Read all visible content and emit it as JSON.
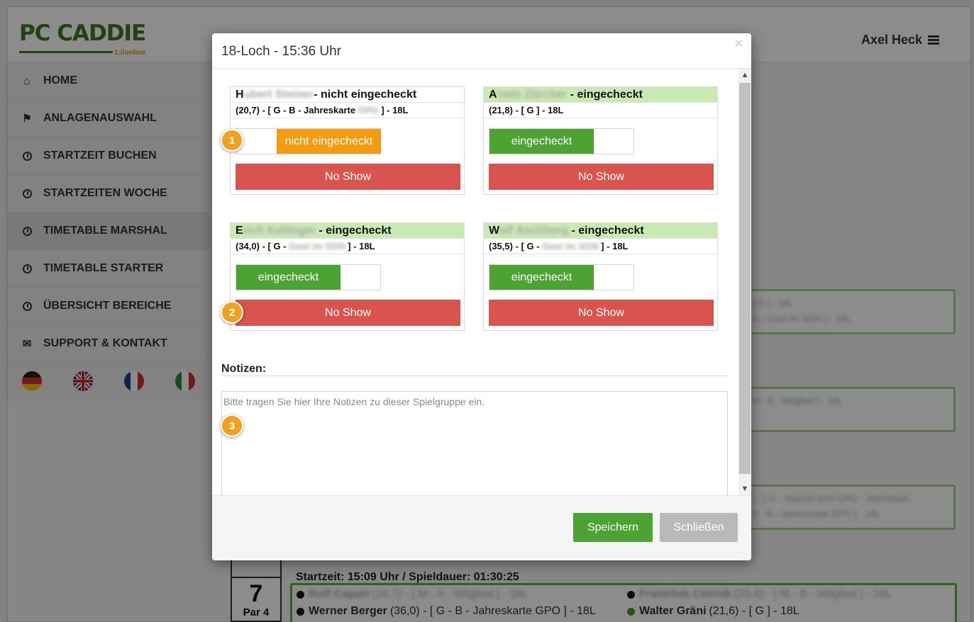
{
  "app": {
    "logo": "PC CADDIE",
    "logo_sub": "1://online",
    "user": "Axel Heck"
  },
  "sidebar": {
    "items": [
      {
        "label": "HOME",
        "icon": "home-icon"
      },
      {
        "label": "ANLAGENAUSWAHL",
        "icon": "flag-icon"
      },
      {
        "label": "STARTZEIT BUCHEN",
        "icon": "clock-icon"
      },
      {
        "label": "STARTZEITEN WOCHE",
        "icon": "clock-icon"
      },
      {
        "label": "TIMETABLE MARSHAL",
        "icon": "clock-icon",
        "active": true
      },
      {
        "label": "TIMETABLE STARTER",
        "icon": "clock-icon"
      },
      {
        "label": "ÜBERSICHT BEREICHE",
        "icon": "clock-icon"
      },
      {
        "label": "SUPPORT & KONTAKT",
        "icon": "envelope-icon"
      }
    ],
    "flags": [
      "german-flag-icon",
      "uk-flag-icon",
      "french-flag-icon",
      "italian-flag-icon"
    ]
  },
  "background": {
    "bg_cards": [
      {
        "line1": "[ G ] - 18L",
        "line2": "G - Gast im SGN ] - 18L"
      },
      {
        "line1": "M - B - Mitglied ] - 18L",
        "line2": ""
      },
      {
        "line1": ") - [ G - Season End GPO - Jahreskart",
        "line2": "S - B - Jahreskarte GPO ] - 18L"
      }
    ],
    "hole": {
      "number": "7",
      "par": "Par 4"
    },
    "startzeit": "Startzeit: 15:09 Uhr / Spieldauer: 01:30:25",
    "players": [
      {
        "name": "Rolf Capatt",
        "detail": "(18,7) - [ M - A - Mitglied ] - 18L"
      },
      {
        "name": "František Ciernik",
        "detail": "(23,6) - [ M - B - Mitglied ] - 18L"
      },
      {
        "name": "Werner Berger",
        "detail": "(36,0) - [ G - B - Jahreskarte GPO ] - 18L"
      },
      {
        "name": "Walter Gräni",
        "detail": "(21,6) - [ G ] - 18L"
      }
    ]
  },
  "modal": {
    "title": "18-Loch - 15:36 Uhr",
    "close_symbol": "×",
    "players": [
      {
        "name_prefix": "H",
        "name_hidden": "ubert Steiner",
        "status": "- nicht eingecheckt",
        "info_prefix": "(20,7) - [ G - B - Jahreskarte ",
        "info_hidden": "GPO",
        "info_suffix": " ] - 18L",
        "toggle_label": "nicht eingecheckt",
        "checked_in": false,
        "noshow_label": "No Show"
      },
      {
        "name_prefix": "A",
        "name_hidden": "rmin Zürcher",
        "status": " - eingecheckt",
        "info_prefix": "(21,8) - [ G ] - 18L",
        "info_hidden": "",
        "info_suffix": "",
        "toggle_label": "eingecheckt",
        "checked_in": true,
        "noshow_label": "No Show"
      },
      {
        "name_prefix": "E",
        "name_hidden": "rich Kallinger",
        "status": " - eingecheckt",
        "info_prefix": "(34,0) - [ G - ",
        "info_hidden": "Gast im SGN",
        "info_suffix": " ] - 18L",
        "toggle_label": "eingecheckt",
        "checked_in": true,
        "noshow_label": "No Show"
      },
      {
        "name_prefix": "W",
        "name_hidden": "olf Aschberg",
        "status": " - eingecheckt",
        "info_prefix": "(35,5) - [ G - ",
        "info_hidden": "Gast im SGN",
        "info_suffix": " ] - 18L",
        "toggle_label": "eingecheckt",
        "checked_in": true,
        "noshow_label": "No Show"
      }
    ],
    "badges": [
      "1",
      "2",
      "3"
    ],
    "notes_label": "Notizen:",
    "notes_placeholder": "Bitte tragen Sie hier Ihre Notizen zu dieser Spielgruppe ein.",
    "save_label": "Speichern",
    "close_label": "Schließen"
  },
  "colors": {
    "brand_green": "#3d7a25",
    "checked_green": "#4ca232",
    "not_checked_orange": "#f39c12",
    "noshow_red": "#d9534f",
    "badge_orange": "#f0a120"
  }
}
